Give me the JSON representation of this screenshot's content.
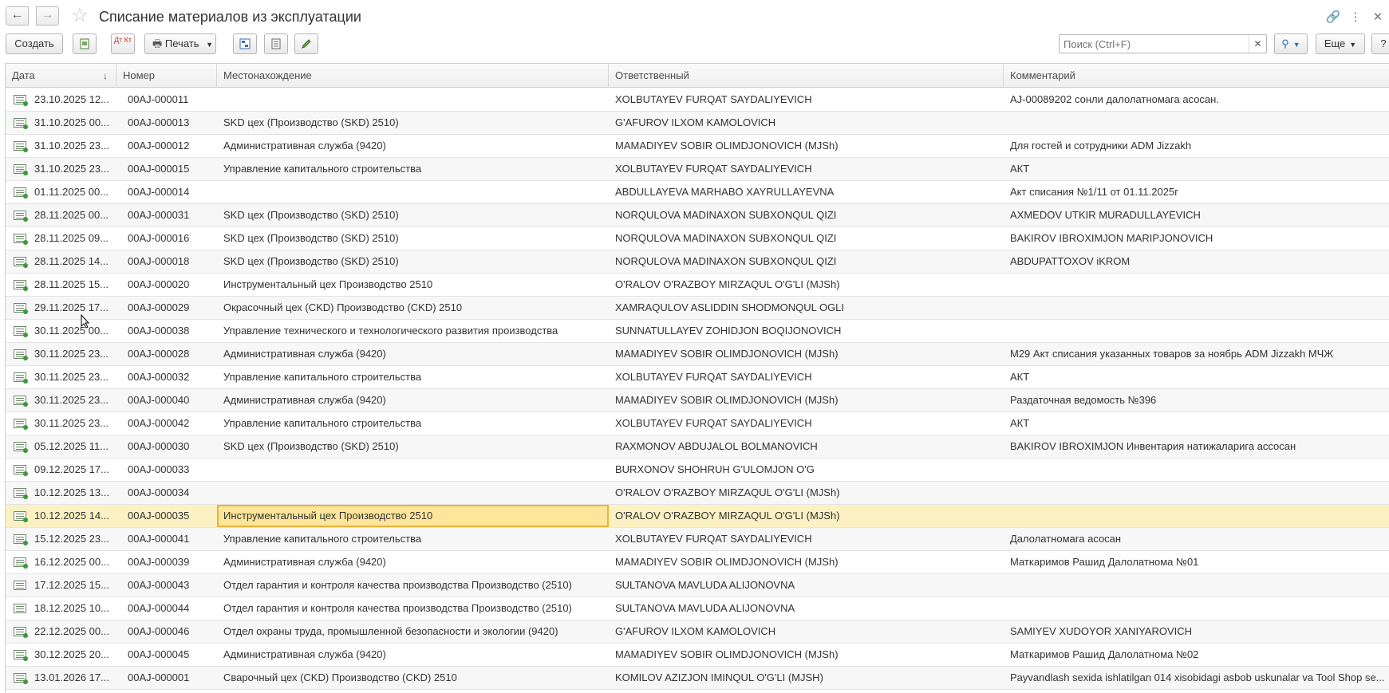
{
  "window": {
    "title": "Списание материалов из эксплуатации"
  },
  "toolbar": {
    "create_label": "Создать",
    "print_label": "Печать",
    "search_placeholder": "Поиск (Ctrl+F)",
    "more_label": "Еще",
    "help_label": "?",
    "dtkt_label": "Дт Кт"
  },
  "table": {
    "columns": [
      "Дата",
      "Номер",
      "Местонахождение",
      "Ответственный",
      "Комментарий"
    ],
    "sort_indicator": "↓",
    "selected_row": 18,
    "rows": [
      {
        "date": "23.10.2025 12...",
        "number": "00AJ-000011",
        "location": "",
        "responsible": "XOLBUTAYEV FURQAT SAYDALIYEVICH",
        "comment": "AJ-00089202 сонли далолатномага асосан.",
        "posted": true
      },
      {
        "date": "31.10.2025 00...",
        "number": "00AJ-000013",
        "location": "SKD цех (Производство (SKD) 2510)",
        "responsible": "G'AFUROV ILXOM KAMOLOVICH",
        "comment": "",
        "posted": true
      },
      {
        "date": "31.10.2025 23...",
        "number": "00AJ-000012",
        "location": "Административная служба (9420)",
        "responsible": "MAMADIYEV SOBIR OLIMDJONOVICH (MJSh)",
        "comment": "Для гостей и сотрудники ADM Jizzakh",
        "posted": true
      },
      {
        "date": "31.10.2025 23...",
        "number": "00AJ-000015",
        "location": "Управление капитального строительства",
        "responsible": "XOLBUTAYEV FURQAT SAYDALIYEVICH",
        "comment": "АКТ",
        "posted": true
      },
      {
        "date": "01.11.2025 00...",
        "number": "00AJ-000014",
        "location": "",
        "responsible": "ABDULLAYEVA MARHABO XAYRULLAYEVNA",
        "comment": "Акт списания   №1/11  от 01.11.2025г",
        "posted": true
      },
      {
        "date": "28.11.2025 00...",
        "number": "00AJ-000031",
        "location": "SKD цех (Производство (SKD) 2510)",
        "responsible": "NORQULOVA MADINAXON SUBXONQUL QIZI",
        "comment": "AXMEDOV UTKIR MURADULLAYEVICH",
        "posted": true
      },
      {
        "date": "28.11.2025 09...",
        "number": "00AJ-000016",
        "location": "SKD цех (Производство (SKD) 2510)",
        "responsible": "NORQULOVA MADINAXON SUBXONQUL QIZI",
        "comment": "BAKIROV IBROXIMJON MARIPJONOVICH",
        "posted": true
      },
      {
        "date": "28.11.2025 14...",
        "number": "00AJ-000018",
        "location": "SKD цех (Производство (SKD) 2510)",
        "responsible": "NORQULOVA MADINAXON SUBXONQUL QIZI",
        "comment": "ABDUPATTOXOV iKROM",
        "posted": true
      },
      {
        "date": "28.11.2025 15...",
        "number": "00AJ-000020",
        "location": "Инструментальный цех Производство 2510",
        "responsible": "O'RALOV O'RAZBOY MIRZAQUL O'G'LI (MJSh)",
        "comment": "",
        "posted": true
      },
      {
        "date": "29.11.2025 17...",
        "number": "00AJ-000029",
        "location": "Окрасочный цех (CKD) Производство (CKD) 2510",
        "responsible": "XAMRAQULOV ASLIDDIN SHODMONQUL OGLI",
        "comment": "",
        "posted": true
      },
      {
        "date": "30.11.2025 00...",
        "number": "00AJ-000038",
        "location": "Управление технического и технологического развития производства",
        "responsible": "SUNNATULLAYEV ZOHIDJON BOQIJONOVICH",
        "comment": "",
        "posted": true
      },
      {
        "date": "30.11.2025 23...",
        "number": "00AJ-000028",
        "location": "Административная служба (9420)",
        "responsible": "MAMADIYEV SOBIR OLIMDJONOVICH (MJSh)",
        "comment": "M29 Акт списания указанных товаров за ноябрь ADM Jizzakh МЧЖ",
        "posted": true
      },
      {
        "date": "30.11.2025 23...",
        "number": "00AJ-000032",
        "location": "Управление капитального строительства",
        "responsible": "XOLBUTAYEV FURQAT SAYDALIYEVICH",
        "comment": "АКТ",
        "posted": true
      },
      {
        "date": "30.11.2025 23...",
        "number": "00AJ-000040",
        "location": "Административная служба (9420)",
        "responsible": "MAMADIYEV SOBIR OLIMDJONOVICH (MJSh)",
        "comment": "Раздаточная ведомость №396",
        "posted": true
      },
      {
        "date": "30.11.2025 23...",
        "number": "00AJ-000042",
        "location": "Управление капитального строительства",
        "responsible": "XOLBUTAYEV FURQAT SAYDALIYEVICH",
        "comment": "АКТ",
        "posted": true
      },
      {
        "date": "05.12.2025 11...",
        "number": "00AJ-000030",
        "location": "SKD цех (Производство (SKD) 2510)",
        "responsible": "RAXMONOV ABDUJALOL BOLMANOVICH",
        "comment": "BAKIROV IBROXIMJON Инвентария  натижаларига  ассосан",
        "posted": true
      },
      {
        "date": "09.12.2025 17...",
        "number": "00AJ-000033",
        "location": "",
        "responsible": "BURXONOV SHOHRUH G'ULOMJON O'G",
        "comment": "",
        "posted": true
      },
      {
        "date": "10.12.2025 13...",
        "number": "00AJ-000034",
        "location": "",
        "responsible": "O'RALOV O'RAZBOY MIRZAQUL O'G'LI (MJSh)",
        "comment": "",
        "posted": true
      },
      {
        "date": "10.12.2025 14...",
        "number": "00AJ-000035",
        "location": "Инструментальный цех Производство 2510",
        "responsible": "O'RALOV O'RAZBOY MIRZAQUL O'G'LI (MJSh)",
        "comment": "",
        "posted": true
      },
      {
        "date": "15.12.2025 23...",
        "number": "00AJ-000041",
        "location": "Управление капитального строительства",
        "responsible": "XOLBUTAYEV FURQAT SAYDALIYEVICH",
        "comment": "Далолатномага асосан",
        "posted": true
      },
      {
        "date": "16.12.2025 00...",
        "number": "00AJ-000039",
        "location": "Административная служба (9420)",
        "responsible": "MAMADIYEV SOBIR OLIMDJONOVICH (MJSh)",
        "comment": "Маткаримов Рашид Далолатнома №01",
        "posted": true
      },
      {
        "date": "17.12.2025 15...",
        "number": "00AJ-000043",
        "location": "Отдел гарантия и контроля качества производства Производство (2510)",
        "responsible": "SULTANOVA MAVLUDA ALIJONOVNA",
        "comment": "",
        "posted": false
      },
      {
        "date": "18.12.2025 10...",
        "number": "00AJ-000044",
        "location": "Отдел гарантия и контроля качества производства Производство (2510)",
        "responsible": "SULTANOVA MAVLUDA ALIJONOVNA",
        "comment": "",
        "posted": false
      },
      {
        "date": "22.12.2025 00...",
        "number": "00AJ-000046",
        "location": "Отдел охраны труда, промышленной безопасности и экологии (9420)",
        "responsible": "G'AFUROV ILXOM KAMOLOVICH",
        "comment": "SAMIYEV XUDOYOR XANIYAROVICH",
        "posted": true
      },
      {
        "date": "30.12.2025 20...",
        "number": "00AJ-000045",
        "location": "Административная служба (9420)",
        "responsible": "MAMADIYEV SOBIR OLIMDJONOVICH (MJSh)",
        "comment": "Маткаримов Рашид Далолатнома №02",
        "posted": true
      },
      {
        "date": "13.01.2026 17...",
        "number": "00AJ-000001",
        "location": "Сварочный цех (CKD) Производство (CKD) 2510",
        "responsible": "KOMILOV AZIZJON IMINQUL O'G'LI (MJSH)",
        "comment": "Payvandlash sexida ishlatilgan 014 xisobidagi asbob uskunalar va Tool Shop se...",
        "posted": true
      }
    ]
  }
}
